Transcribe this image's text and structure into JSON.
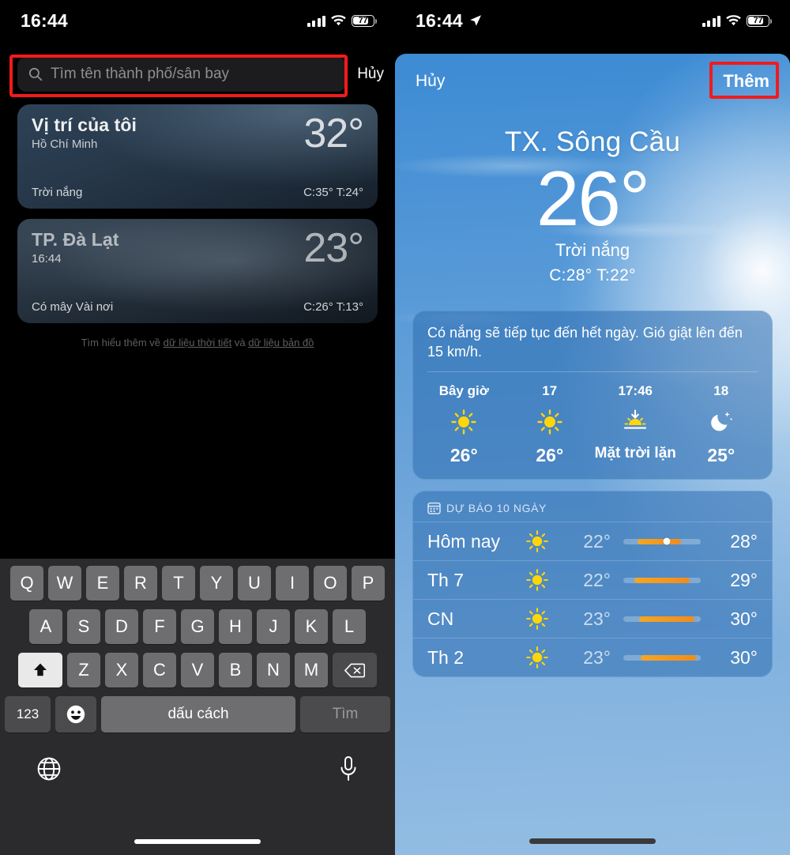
{
  "left": {
    "status": {
      "time": "16:44",
      "battery": "77",
      "signal_icon": "cellular-bars-icon",
      "wifi_icon": "wifi-icon",
      "battery_icon": "battery-icon"
    },
    "search": {
      "placeholder": "Tìm tên thành phố/sân bay",
      "cancel_label": "Hủy",
      "icon": "search-icon",
      "highlight_color": "#f11b1b"
    },
    "cards": [
      {
        "name": "Vị trí của tôi",
        "sub": "Hồ Chí Minh",
        "temp": "32°",
        "condition": "Trời nắng",
        "hilo": "C:35°  T:24°"
      },
      {
        "name": "TP. Đà Lạt",
        "sub": "16:44",
        "temp": "23°",
        "condition": "Có mây Vài nơi",
        "hilo": "C:26°  T:13°"
      }
    ],
    "footer": {
      "prefix": "Tìm hiểu thêm về ",
      "link1": "dữ liệu thời tiết",
      "middle": " và ",
      "link2": "dữ liệu bản đồ"
    },
    "keyboard": {
      "row1": [
        "Q",
        "W",
        "E",
        "R",
        "T",
        "Y",
        "U",
        "I",
        "O",
        "P"
      ],
      "row2": [
        "A",
        "S",
        "D",
        "F",
        "G",
        "H",
        "J",
        "K",
        "L"
      ],
      "row3": [
        "Z",
        "X",
        "C",
        "V",
        "B",
        "N",
        "M"
      ],
      "shift_icon": "shift-arrow-icon",
      "backspace_icon": "backspace-icon",
      "numbers_label": "123",
      "emoji_icon": "emoji-smiley-icon",
      "space_label": "dấu cách",
      "go_label": "Tìm",
      "globe_icon": "globe-icon",
      "mic_icon": "microphone-icon"
    }
  },
  "right": {
    "status": {
      "time": "16:44",
      "battery": "77",
      "location_icon": "location-arrow-icon",
      "signal_icon": "cellular-bars-icon",
      "wifi_icon": "wifi-icon",
      "battery_icon": "battery-icon"
    },
    "sheet": {
      "cancel_label": "Hủy",
      "add_label": "Thêm",
      "highlight_color": "#f11b1b"
    },
    "hero": {
      "city": "TX. Sông Cầu",
      "temp": "26°",
      "condition": "Trời nắng",
      "hilo": "C:28°  T:22°"
    },
    "summary": "Có nắng sẽ tiếp tục đến hết ngày. Gió giật lên đến 15 km/h.",
    "hourly": [
      {
        "label": "Bây giờ",
        "icon": "sun-icon",
        "value": "26°"
      },
      {
        "label": "17",
        "icon": "sun-icon",
        "value": "26°"
      },
      {
        "label": "17:46",
        "icon": "sunset-icon",
        "value": "Mặt trời lặn"
      },
      {
        "label": "18",
        "icon": "moon-stars-icon",
        "value": "25°"
      }
    ],
    "daily": {
      "header": "DỰ BÁO 10 NGÀY",
      "header_icon": "calendar-icon",
      "rows": [
        {
          "day": "Hôm nay",
          "icon": "sun-icon",
          "low": "22°",
          "high": "28°",
          "bar_start": 18,
          "bar_end": 74,
          "dot": 56
        },
        {
          "day": "Th 7",
          "icon": "sun-icon",
          "low": "22°",
          "high": "29°",
          "bar_start": 14,
          "bar_end": 86,
          "dot": null
        },
        {
          "day": "CN",
          "icon": "sun-icon",
          "low": "23°",
          "high": "30°",
          "bar_start": 20,
          "bar_end": 92,
          "dot": null
        },
        {
          "day": "Th 2",
          "icon": "sun-icon",
          "low": "23°",
          "high": "30°",
          "bar_start": 22,
          "bar_end": 94,
          "dot": null
        }
      ]
    }
  }
}
